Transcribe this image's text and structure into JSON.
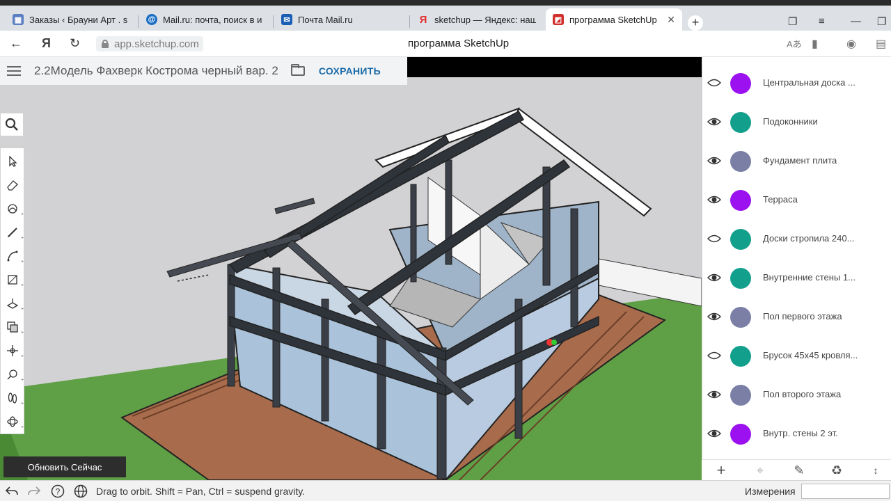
{
  "browser": {
    "tabs": [
      {
        "title": "Заказы ‹ Брауни Арт . shop",
        "favicon": "store-icon",
        "color": "#5b7ec1"
      },
      {
        "title": "Mail.ru: почта, поиск в инте",
        "favicon": "mailru-icon",
        "color": "#1a6ec4"
      },
      {
        "title": "Почта Mail.ru",
        "favicon": "mail-envelope-icon",
        "color": "#1a5fb4"
      },
      {
        "title": "sketchup — Яндекс: нашлось",
        "favicon": "yandex-icon",
        "color": "#e32d2d"
      },
      {
        "title": "программа SketchUp",
        "favicon": "sketchup-icon",
        "color": "#d0312d"
      }
    ],
    "close_glyph": "✕",
    "new_tab_glyph": "+",
    "yandex_glyph": "Я",
    "url": "app.sketchup.com",
    "page_title": "программа SketchUp"
  },
  "app": {
    "document_title": "2.2Модель Фахверк Кострома черный вар. 2",
    "save_label": "СОХРАНИТЬ",
    "update_button": "Обновить Сейчас",
    "status_text": "Drag to orbit. Shift = Pan, Ctrl = suspend gravity.",
    "measurements_label": "Измерения",
    "measurements_value": "",
    "tools": [
      "select-tool-icon",
      "eraser-tool-icon",
      "paint-bucket-tool-icon",
      "pencil-tool-icon",
      "arc-tool-icon",
      "rectangle-tool-icon",
      "push-pull-tool-icon",
      "offset-tool-icon",
      "move-tool-icon",
      "tape-measure-tool-icon",
      "walk-tool-icon",
      "orbit-tool-icon"
    ]
  },
  "layers": [
    {
      "name": "Центральная доска ...",
      "color": "#9b11f0",
      "visible": "outline"
    },
    {
      "name": "Подоконники",
      "color": "#12a08d",
      "visible": "filled"
    },
    {
      "name": "Фундамент плита",
      "color": "#7b7fa6",
      "visible": "filled"
    },
    {
      "name": "Терраса",
      "color": "#9b11f0",
      "visible": "filled"
    },
    {
      "name": "Доски стропила 240...",
      "color": "#12a08d",
      "visible": "outline"
    },
    {
      "name": "Внутренние стены 1...",
      "color": "#12a08d",
      "visible": "filled"
    },
    {
      "name": "Пол первого этажа",
      "color": "#7b7fa6",
      "visible": "filled"
    },
    {
      "name": "Брусок 45х45 кровля...",
      "color": "#12a08d",
      "visible": "outline"
    },
    {
      "name": "Пол второго этажа",
      "color": "#7b7fa6",
      "visible": "filled"
    },
    {
      "name": "Внутр. стены 2 эт.",
      "color": "#9b11f0",
      "visible": "filled"
    }
  ]
}
